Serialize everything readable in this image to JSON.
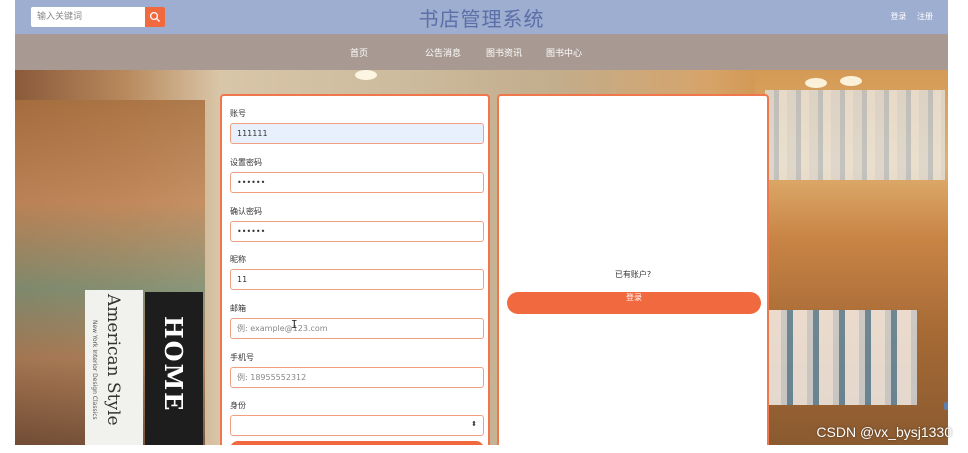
{
  "header": {
    "search_placeholder": "输入关键词",
    "site_title": "书店管理系统",
    "login_link": "登录",
    "register_link": "注册"
  },
  "nav": {
    "items": [
      "首页",
      "公告消息",
      "图书资讯",
      "图书中心"
    ]
  },
  "background_books": {
    "white_book_title": "American Style",
    "white_book_subtitle": "New York Interior Design Classics",
    "black_book_title": "HOME"
  },
  "register_form": {
    "account_label": "账号",
    "account_value": "111111",
    "password_label": "设置密码",
    "password_value": "••••••",
    "confirm_label": "确认密码",
    "confirm_value": "••••••",
    "nickname_label": "昵称",
    "nickname_value": "11",
    "email_label": "邮箱",
    "email_placeholder": "例: example@123.com",
    "phone_label": "手机号",
    "phone_placeholder": "例: 18955552312",
    "identity_label": "身份",
    "identity_value": ""
  },
  "side_panel": {
    "prompt": "已有账户?",
    "login_button": "登录"
  },
  "watermark": "CSDN @vx_bysj1330",
  "colors": {
    "header_bg": "#9eaed0",
    "nav_bg": "#a89a92",
    "accent": "#f0693f",
    "title": "#5b6fa8"
  }
}
